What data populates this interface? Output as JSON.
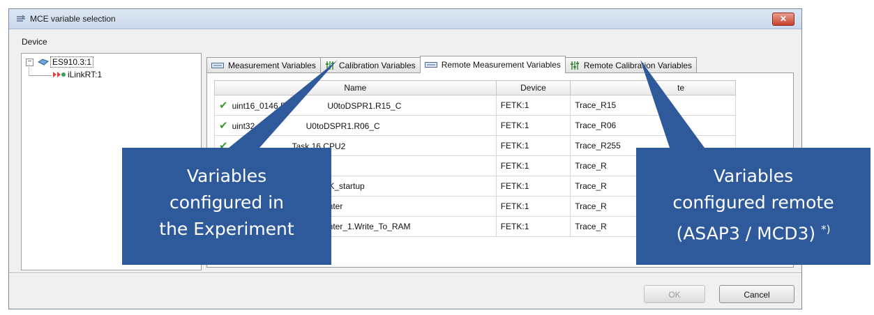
{
  "window": {
    "title": "MCE variable selection",
    "close_label": "✕"
  },
  "device": {
    "label": "Device",
    "tree": {
      "root_label": "ES910.3:1",
      "root_expander": "⊟",
      "child_label": "iLinkRT:1"
    }
  },
  "tabs": [
    {
      "label": "Measurement Variables"
    },
    {
      "label": "Calibration Variables"
    },
    {
      "label": "Remote Measurement Variables"
    },
    {
      "label": "Remote Calibration Variables"
    }
  ],
  "active_tab": "Remote Measurement Variables",
  "table": {
    "columns": [
      "Name",
      "Device",
      "te"
    ],
    "rows": [
      {
        "name": "uint16_0146.F",
        "name2": "U0toDSPR1.R15_C",
        "device": "FETK:1",
        "trace": "Trace_R15"
      },
      {
        "name": "uint32_0",
        "name2": "U0toDSPR1.R06_C",
        "device": "FETK:1",
        "trace": "Trace_R06"
      },
      {
        "name": "uin",
        "name2": "Task 16.CPU2",
        "device": "FETK:1",
        "trace": "Trace_R255"
      },
      {
        "name": "",
        "name2": "",
        "device": "FETK:1",
        "trace": "Trace_R"
      },
      {
        "name": "",
        "name2": "TK_startup",
        "device": "FETK:1",
        "trace": "Trace_R"
      },
      {
        "name": "",
        "name2": "unter",
        "device": "FETK:1",
        "trace": "Trace_R"
      },
      {
        "name": "",
        "name2": "unter_1.Write_To_RAM",
        "device": "FETK:1",
        "trace": "Trace_R"
      }
    ]
  },
  "buttons": {
    "ok_label": "OK",
    "cancel_label": "Cancel"
  },
  "callouts": {
    "left": {
      "line1": "Variables",
      "line2": "configured in",
      "line3": "the Experiment"
    },
    "right": {
      "line1": "Variables",
      "line2": "configured remote",
      "line3": "(ASAP3 / MCD3)",
      "note": "*)"
    }
  },
  "colors": {
    "callout_bg": "#2e5a9c",
    "check_green": "#3b9a2d",
    "close_red": "#c8412b"
  }
}
